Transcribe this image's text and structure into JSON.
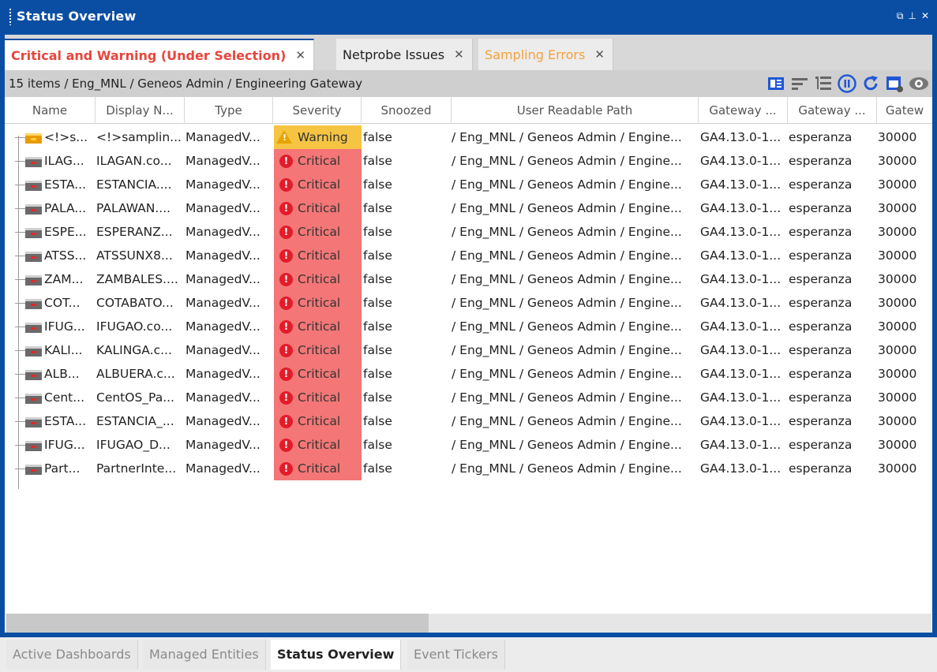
{
  "window": {
    "title": "Status Overview",
    "controls": [
      "⧉",
      "⊥",
      "✕"
    ]
  },
  "tabs": [
    {
      "label": "Critical and Warning (Under Selection)",
      "color": "#e8453c"
    },
    {
      "label": "Netprobe Issues",
      "color": "#222222"
    },
    {
      "label": "Sampling Errors",
      "color": "#f2a23c"
    }
  ],
  "toolbar": {
    "breadcrumb": "15 items  / Eng_MNL / Geneos Admin / Engineering Gateway"
  },
  "columns": [
    "Name",
    "Display N...",
    "Type",
    "Severity",
    "Snoozed",
    "User Readable Path",
    "Gateway ...",
    "Gateway ...",
    "Gatew"
  ],
  "rows": [
    {
      "name": "<!>s...",
      "display": "<!>samplin...",
      "type": "ManagedV...",
      "severity": "Warning",
      "snoozed": "false",
      "path": "/ Eng_MNL / Geneos Admin / Engine...",
      "gw1": "GA4.13.0-1...",
      "gw2": "esperanza",
      "gw3": "30000"
    },
    {
      "name": "ILAG...",
      "display": "ILAGAN.co...",
      "type": "ManagedV...",
      "severity": "Critical",
      "snoozed": "false",
      "path": "/ Eng_MNL / Geneos Admin / Engine...",
      "gw1": "GA4.13.0-1...",
      "gw2": "esperanza",
      "gw3": "30000"
    },
    {
      "name": "ESTA...",
      "display": "ESTANCIA....",
      "type": "ManagedV...",
      "severity": "Critical",
      "snoozed": "false",
      "path": "/ Eng_MNL / Geneos Admin / Engine...",
      "gw1": "GA4.13.0-1...",
      "gw2": "esperanza",
      "gw3": "30000"
    },
    {
      "name": "PALA...",
      "display": "PALAWAN....",
      "type": "ManagedV...",
      "severity": "Critical",
      "snoozed": "false",
      "path": "/ Eng_MNL / Geneos Admin / Engine...",
      "gw1": "GA4.13.0-1...",
      "gw2": "esperanza",
      "gw3": "30000"
    },
    {
      "name": "ESPE...",
      "display": "ESPERANZ...",
      "type": "ManagedV...",
      "severity": "Critical",
      "snoozed": "false",
      "path": "/ Eng_MNL / Geneos Admin / Engine...",
      "gw1": "GA4.13.0-1...",
      "gw2": "esperanza",
      "gw3": "30000"
    },
    {
      "name": "ATSS...",
      "display": "ATSSUNX8...",
      "type": "ManagedV...",
      "severity": "Critical",
      "snoozed": "false",
      "path": "/ Eng_MNL / Geneos Admin / Engine...",
      "gw1": "GA4.13.0-1...",
      "gw2": "esperanza",
      "gw3": "30000"
    },
    {
      "name": "ZAM...",
      "display": "ZAMBALES....",
      "type": "ManagedV...",
      "severity": "Critical",
      "snoozed": "false",
      "path": "/ Eng_MNL / Geneos Admin / Engine...",
      "gw1": "GA4.13.0-1...",
      "gw2": "esperanza",
      "gw3": "30000"
    },
    {
      "name": "COT...",
      "display": "COTABATO...",
      "type": "ManagedV...",
      "severity": "Critical",
      "snoozed": "false",
      "path": "/ Eng_MNL / Geneos Admin / Engine...",
      "gw1": "GA4.13.0-1...",
      "gw2": "esperanza",
      "gw3": "30000"
    },
    {
      "name": "IFUG...",
      "display": "IFUGAO.co...",
      "type": "ManagedV...",
      "severity": "Critical",
      "snoozed": "false",
      "path": "/ Eng_MNL / Geneos Admin / Engine...",
      "gw1": "GA4.13.0-1...",
      "gw2": "esperanza",
      "gw3": "30000"
    },
    {
      "name": "KALI...",
      "display": "KALINGA.c...",
      "type": "ManagedV...",
      "severity": "Critical",
      "snoozed": "false",
      "path": "/ Eng_MNL / Geneos Admin / Engine...",
      "gw1": "GA4.13.0-1...",
      "gw2": "esperanza",
      "gw3": "30000"
    },
    {
      "name": "ALB...",
      "display": "ALBUERA.c...",
      "type": "ManagedV...",
      "severity": "Critical",
      "snoozed": "false",
      "path": "/ Eng_MNL / Geneos Admin / Engine...",
      "gw1": "GA4.13.0-1...",
      "gw2": "esperanza",
      "gw3": "30000"
    },
    {
      "name": "Cent...",
      "display": "CentOS_Pa...",
      "type": "ManagedV...",
      "severity": "Critical",
      "snoozed": "false",
      "path": "/ Eng_MNL / Geneos Admin / Engine...",
      "gw1": "GA4.13.0-1...",
      "gw2": "esperanza",
      "gw3": "30000"
    },
    {
      "name": "ESTA...",
      "display": "ESTANCIA_...",
      "type": "ManagedV...",
      "severity": "Critical",
      "snoozed": "false",
      "path": "/ Eng_MNL / Geneos Admin / Engine...",
      "gw1": "GA4.13.0-1...",
      "gw2": "esperanza",
      "gw3": "30000"
    },
    {
      "name": "IFUG...",
      "display": "IFUGAO_D...",
      "type": "ManagedV...",
      "severity": "Critical",
      "snoozed": "false",
      "path": "/ Eng_MNL / Geneos Admin / Engine...",
      "gw1": "GA4.13.0-1...",
      "gw2": "esperanza",
      "gw3": "30000"
    },
    {
      "name": "Part...",
      "display": "PartnerInte...",
      "type": "ManagedV...",
      "severity": "Critical",
      "snoozed": "false",
      "path": "/ Eng_MNL / Geneos Admin / Engine...",
      "gw1": "GA4.13.0-1...",
      "gw2": "esperanza",
      "gw3": "30000"
    }
  ],
  "bottom_tabs": [
    "Active Dashboards",
    "Managed Entities",
    "Status Overview",
    "Event Tickers"
  ],
  "colors": {
    "accent": "#0a4ea3",
    "critical": "#f47676",
    "warning": "#f6c443"
  }
}
